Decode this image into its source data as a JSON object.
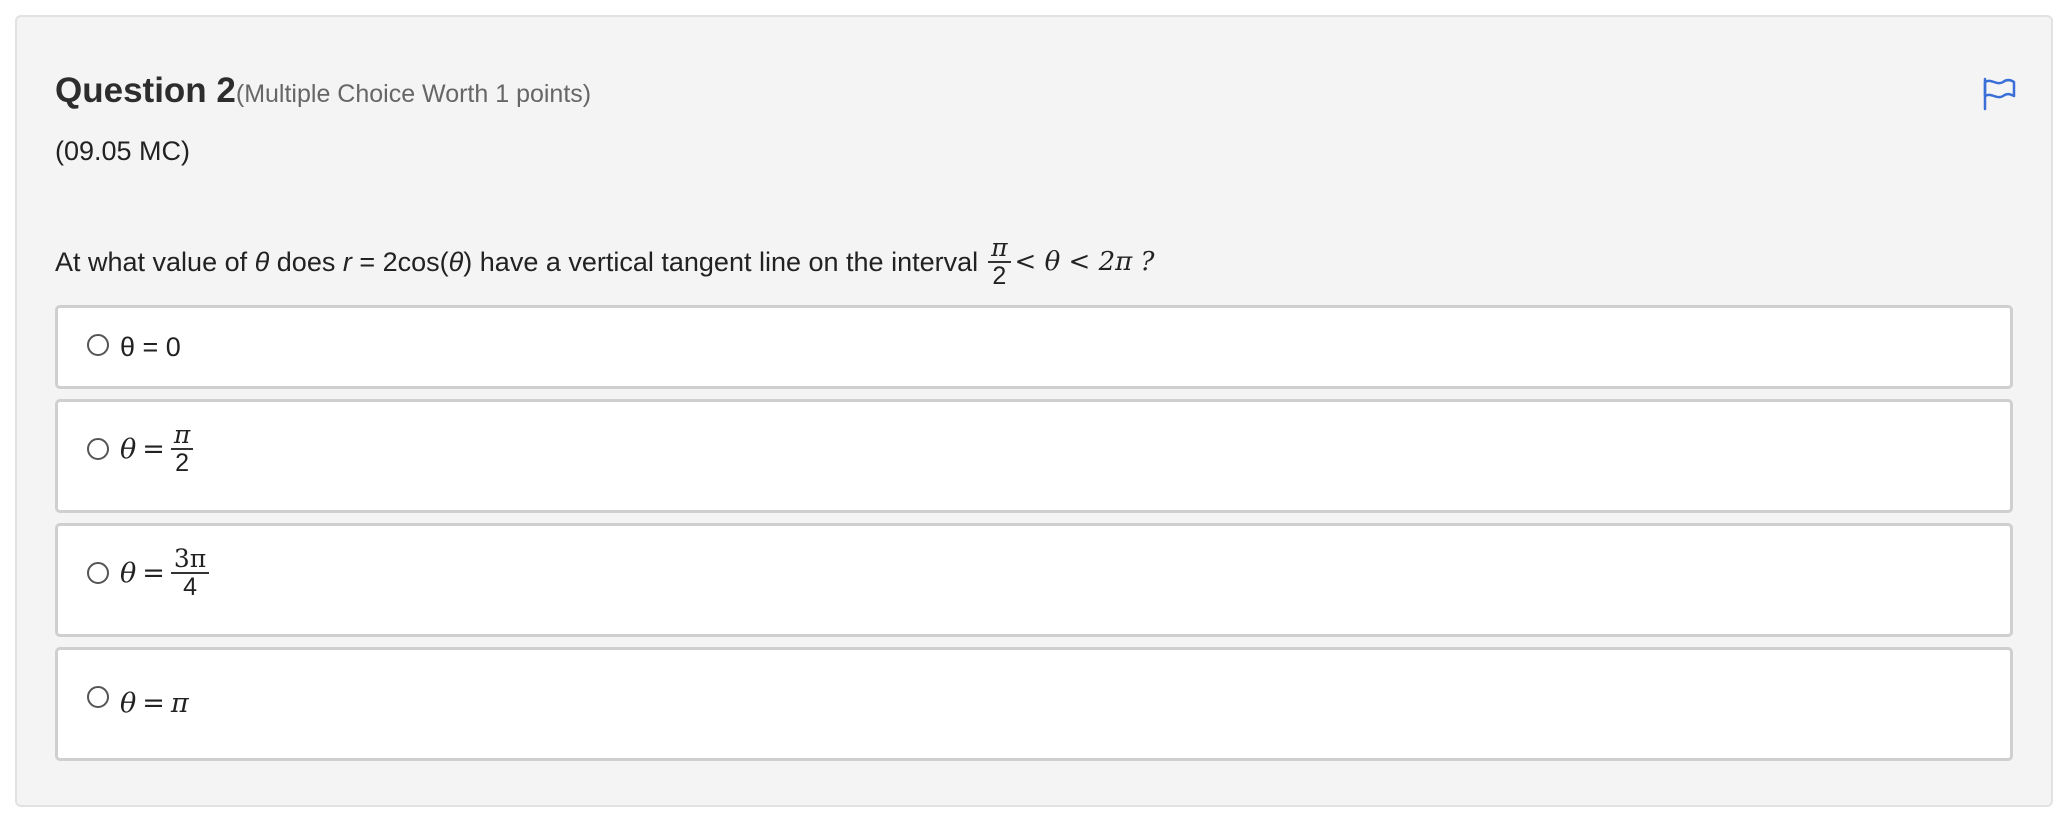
{
  "question": {
    "title": "Question 2",
    "meta": "(Multiple Choice Worth 1 points)",
    "code": "(09.05 MC)",
    "text_prefix": "At what value of ",
    "theta": "θ",
    "text_middle_1": " does ",
    "r_var": "r",
    "text_middle_2": " = 2cos(",
    "text_middle_3": ") have a vertical tangent line on the interval",
    "interval": {
      "numerator": "π",
      "denominator": "2",
      "rest": "< θ < 2π ?"
    }
  },
  "options": [
    {
      "label": "θ = 0"
    },
    {
      "theta": "θ",
      "eq": "=",
      "numerator": "π",
      "denominator": "2"
    },
    {
      "theta": "θ",
      "eq": "=",
      "numerator": "3π",
      "denominator": "4"
    },
    {
      "theta": "θ",
      "eq": "=",
      "value": "π"
    }
  ],
  "icons": {
    "flag": "flag-icon",
    "radio": "radio-button"
  },
  "colors": {
    "flag": "#3a6fd8",
    "panel_background": "#f4f4f4",
    "option_border": "#cfcfcf"
  }
}
